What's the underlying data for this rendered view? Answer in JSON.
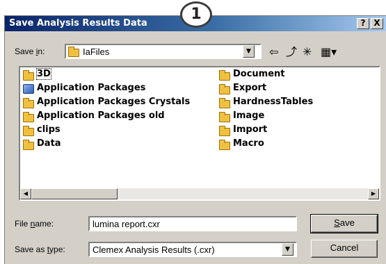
{
  "window": {
    "title": "Save Analysis Results Data",
    "help_label": "?",
    "close_label": "X"
  },
  "callout": {
    "number": "1"
  },
  "save_in": {
    "label_pre": "Save ",
    "label_key": "i",
    "label_post": "n:",
    "value": "IaFiles"
  },
  "toolbar": {
    "back_icon": "⇦",
    "up_icon": "⤴",
    "new_folder_icon": "✳",
    "view_icon": "▦▾"
  },
  "files": {
    "left": [
      {
        "name": "3D",
        "type": "folder"
      },
      {
        "name": "Application Packages",
        "type": "package"
      },
      {
        "name": "Application Packages Crystals",
        "type": "folder"
      },
      {
        "name": "Application Packages old",
        "type": "folder"
      },
      {
        "name": "clips",
        "type": "folder"
      },
      {
        "name": "Data",
        "type": "folder"
      }
    ],
    "right": [
      {
        "name": "Document",
        "type": "folder"
      },
      {
        "name": "Export",
        "type": "folder"
      },
      {
        "name": "HardnessTables",
        "type": "folder"
      },
      {
        "name": "Image",
        "type": "folder"
      },
      {
        "name": "Import",
        "type": "folder"
      },
      {
        "name": "Macro",
        "type": "folder"
      }
    ]
  },
  "file_name": {
    "label_pre": "File ",
    "label_key": "n",
    "label_post": "ame:",
    "value": "lumina report.cxr"
  },
  "save_as_type": {
    "label_pre": "Save as ",
    "label_key": "t",
    "label_post": "ype:",
    "value": "Clemex Analysis Results (.cxr)"
  },
  "buttons": {
    "save_key": "S",
    "save_rest": "ave",
    "cancel": "Cancel"
  }
}
